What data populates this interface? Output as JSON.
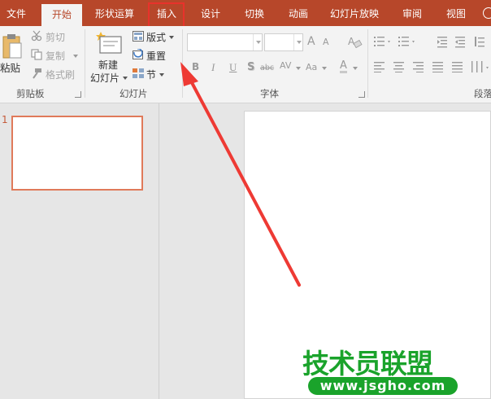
{
  "tabs": [
    {
      "label": "文件"
    },
    {
      "label": "开始"
    },
    {
      "label": "形状运算"
    },
    {
      "label": "插入"
    },
    {
      "label": "设计"
    },
    {
      "label": "切换"
    },
    {
      "label": "动画"
    },
    {
      "label": "幻灯片放映"
    },
    {
      "label": "审阅"
    },
    {
      "label": "视图"
    }
  ],
  "active_tab": "开始",
  "highlighted_tab": "插入",
  "ribbon": {
    "clipboard": {
      "paste_label": "粘贴",
      "cut_label": "剪切",
      "copy_label": "复制",
      "format_painter_label": "格式刷",
      "group_label": "剪贴板"
    },
    "slides": {
      "new_slide_label_1": "新建",
      "new_slide_label_2": "幻灯片",
      "layout_label": "版式",
      "reset_label": "重置",
      "section_label": "节",
      "group_label": "幻灯片"
    },
    "font": {
      "font_name_value": "",
      "font_size_value": "",
      "bold_label": "B",
      "italic_label": "I",
      "underline_label": "U",
      "shadow_label": "S",
      "strike_label": "abc",
      "spacing_label": "AV",
      "case_label": "Aa",
      "color_label": "A",
      "grow_label": "A",
      "shrink_label": "A",
      "group_label": "字体"
    },
    "paragraph": {
      "group_label": "段落"
    }
  },
  "slide_panel": {
    "slide_number": "1"
  },
  "watermark": {
    "title": "技术员联盟",
    "url": "www.jsgho.com"
  },
  "colors": {
    "tabbar": "#b7472a",
    "highlight_box": "#e8322b",
    "arrow": "#ee3a34",
    "watermark": "#1aa32b"
  }
}
